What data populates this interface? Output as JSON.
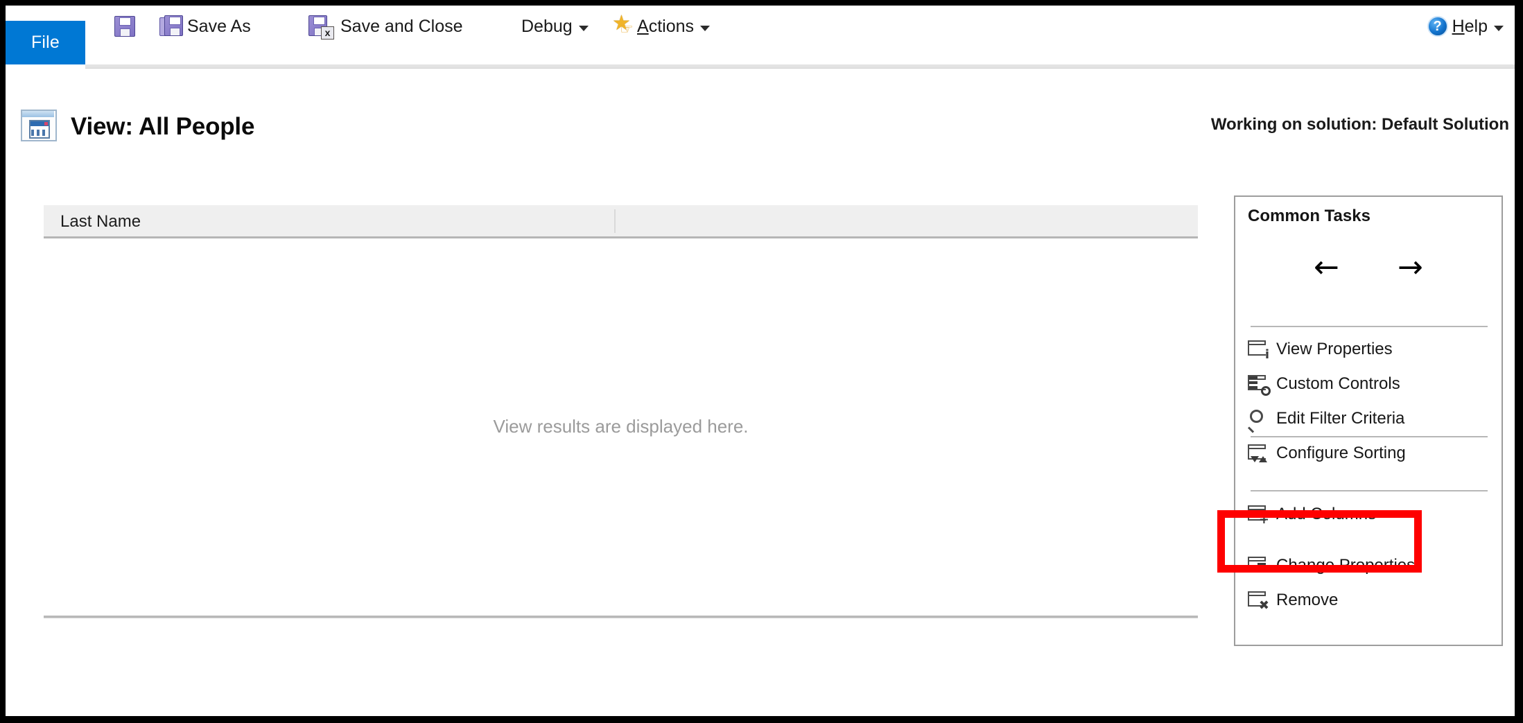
{
  "ribbon": {
    "file_tab": "File",
    "save_title": "Save",
    "save_as": "Save As",
    "save_and_close": "Save and Close",
    "debug": "Debug",
    "actions": "Actions",
    "actions_accel": "A",
    "actions_rest": "ctions",
    "help": "Help",
    "help_accel": "H",
    "help_rest": "elp",
    "help_glyph": "?"
  },
  "header": {
    "title": "View: All People",
    "solution_note": "Working on solution: Default Solution"
  },
  "grid": {
    "columns": [
      "Last Name",
      ""
    ],
    "rows": [],
    "empty_message": "View results are displayed here."
  },
  "tasks_panel": {
    "title": "Common Tasks",
    "nav_back_glyph": "←",
    "nav_forward_glyph": "→",
    "items": [
      {
        "label": "View Properties"
      },
      {
        "label": "Custom Controls"
      },
      {
        "label": "Edit Filter Criteria"
      },
      {
        "label": "Configure Sorting"
      },
      {
        "label": "Add Columns"
      },
      {
        "label": "Change Properties"
      },
      {
        "label": "Remove"
      }
    ]
  },
  "annotation": {
    "highlight_color": "#fe0000",
    "highlight_target": "Add Columns"
  },
  "colors": {
    "file_tab_blue": "#0078d4",
    "grid_header_gray": "#efefef",
    "empty_text_gray": "#9b9b9b",
    "panel_border": "#9d9d9d",
    "frame_border": "#000000"
  }
}
